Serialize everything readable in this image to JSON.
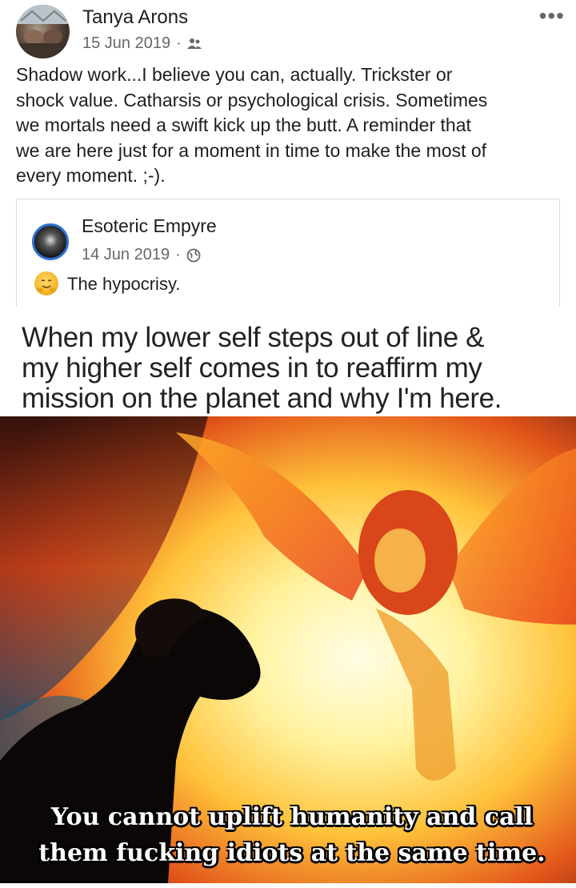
{
  "post": {
    "author": "Tanya Arons",
    "date": "15 Jun 2019",
    "audience_icon": "friends-icon",
    "more_icon": "•••",
    "text": "Shadow work...I believe you can, actually.  Trickster or\nshock value.  Catharsis or psychological crisis.  Sometimes\nwe mortals need a swift kick up the butt.  A reminder that\nwe are here just for a moment in time to make the most of\nevery moment. ;-)."
  },
  "shared": {
    "author": "Esoteric Empyre",
    "date": "14 Jun 2019",
    "audience_icon": "globe-icon",
    "emoji": "hugging-face",
    "text": "The hypocrisy."
  },
  "meme": {
    "top_caption": "When my lower self steps out of line &\nmy higher self comes in to reaffirm my\nmission on the planet and why I'm here.",
    "bottom_caption_line1": "You cannot uplift humanity and call",
    "bottom_caption_line2": "them fucking idiots at the same time."
  },
  "colors": {
    "meta_gray": "#65676b",
    "border": "#d8dadf",
    "avatar_ring": "#2d6fd6"
  }
}
